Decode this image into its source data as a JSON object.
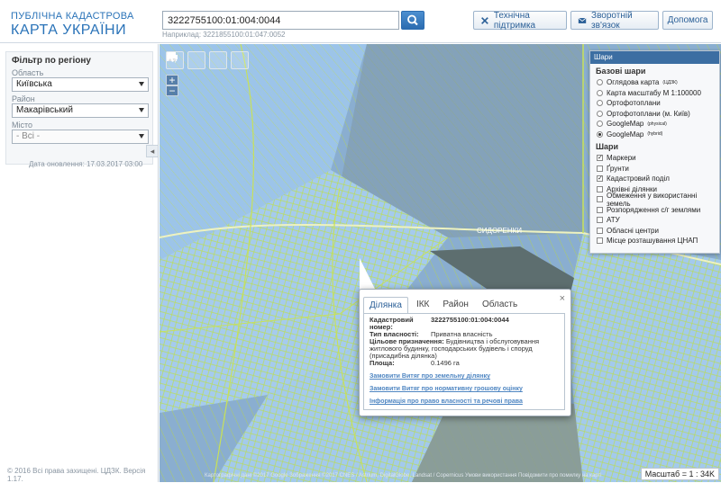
{
  "header": {
    "logo_line1": "ПУБЛІЧНА КАДАСТРОВА",
    "logo_line2": "КАРТА УКРАЇНИ",
    "search_value": "3222755100:01:004:0044",
    "search_hint": "Наприклад: 3221855100:01:047:0052",
    "btn_support": "Технічна підтримка",
    "btn_feedback": "Зворотній зв'язок",
    "btn_help": "Допомога"
  },
  "filter": {
    "title": "Фільтр по регіону",
    "oblast_label": "Область",
    "oblast_value": "Київська",
    "rayon_label": "Район",
    "rayon_value": "Макарівський",
    "misto_label": "Місто",
    "misto_value": "- Всі -",
    "update_date": "Дата оновлення: 17.03.2017 03:00",
    "copyright": "© 2016 Всі права захищені. ЦДЗК. Версія 1.17."
  },
  "map_tools": [
    "I м",
    "I га",
    "print",
    "cursor"
  ],
  "zoom": {
    "plus": "+",
    "minus": "−"
  },
  "layers": {
    "title": "Шари",
    "base_title": "Базові шари",
    "base": [
      {
        "label": "Оглядова карта",
        "sup": "(ЦДЗК)",
        "on": false
      },
      {
        "label": "Карта масштабу М 1:100000",
        "sup": "",
        "on": false
      },
      {
        "label": "Ортофотоплани",
        "sup": "",
        "on": false
      },
      {
        "label": "Ортофотоплани (м. Київ)",
        "sup": "",
        "on": false
      },
      {
        "label": "GoogleMap",
        "sup": "(physical)",
        "on": false
      },
      {
        "label": "GoogleMap",
        "sup": "(hybrid)",
        "on": true
      }
    ],
    "layers_title": "Шари",
    "overlays": [
      {
        "label": "Маркери",
        "on": true
      },
      {
        "label": "Ґрунти",
        "on": false
      },
      {
        "label": "Кадастровий поділ",
        "on": true
      },
      {
        "label": "Архівні ділянки",
        "on": false
      },
      {
        "label": "Обмеження у використанні земель",
        "on": false
      },
      {
        "label": "Розпорядження с/г землями",
        "on": false
      },
      {
        "label": "АТУ",
        "on": false
      },
      {
        "label": "Обласні центри",
        "on": false
      },
      {
        "label": "Місце розташування ЦНАП",
        "on": false
      }
    ]
  },
  "popup": {
    "tabs": [
      "Ділянка",
      "ІКК",
      "Район",
      "Область"
    ],
    "close": "×",
    "fields": [
      {
        "k": "Кадастровий номер:",
        "v": "3222755100:01:004:0044"
      },
      {
        "k": "Тип власності:",
        "v": "Приватна власність"
      },
      {
        "k": "Цільове призначення:",
        "v": "Будівництва і обслуговування житлового будинку, господарських будівель і споруд (присадибна ділянка)"
      },
      {
        "k": "Площа:",
        "v": "0.1496 га"
      }
    ],
    "links": [
      "Замовити Витяг про земельну ділянку",
      "Замовити Витяг про нормативну грошову оцінку",
      "Інформація про право власності та речові права"
    ]
  },
  "map": {
    "attribution": "Картографічні дані ©2017 Google  Зображення ©2017 CNES / Astrium, DigitalGlobe, Landsat / Copernicus  Умови використання  Повідомити про помилку на карті",
    "scale": "Масштаб = 1 : 34K",
    "village_label": "СИДОРЕНКИ"
  },
  "colors": {
    "brand": "#2a73b8",
    "parcel_fill": "#9fc8ef",
    "parcel_line": "#b8e04a"
  }
}
